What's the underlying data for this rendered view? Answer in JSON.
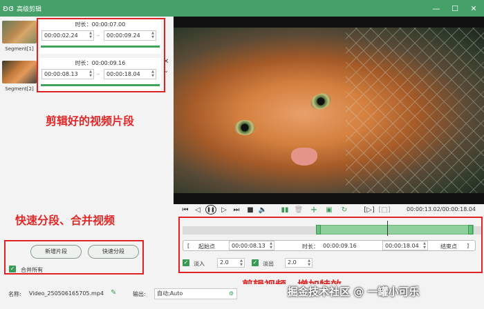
{
  "window": {
    "title": "高级剪辑",
    "min_icon": "minimize-icon",
    "max_icon": "maximize-icon",
    "close_icon": "close-icon"
  },
  "segments": [
    {
      "label": "Segment[1]",
      "duration": "时长：00:00:07.00",
      "start": "00:00:02.24",
      "end": "00:00:09.24"
    },
    {
      "label": "Segment[2]",
      "duration": "时长：00:00:09.16",
      "start": "00:00:08.13",
      "end": "00:00:18.04"
    }
  ],
  "annotations": {
    "clips": "剪辑好的视频片段",
    "split_merge": "快速分段、合并视频",
    "edit_effects": "剪辑视频、增加特效"
  },
  "left_buttons": {
    "add_segment": "新增片段",
    "quick_split": "快速分段",
    "merge_all": "合并所有"
  },
  "player": {
    "time_readout": "00:00:13.02/00:00:18.04"
  },
  "range": {
    "start_label": "起始点",
    "start_value": "00:00:08.13",
    "duration_label": "时长：",
    "duration_value": "00:00:09.16",
    "end_value": "00:00:18.04",
    "end_label": "结束点",
    "bracket_left": "[",
    "bracket_right": "]"
  },
  "fades": {
    "fade_in_label": "淡入",
    "fade_in_value": "2.0",
    "fade_out_label": "淡出",
    "fade_out_value": "2.0"
  },
  "footer": {
    "name_label": "名称:",
    "name_value": "Video_250506165705.mp4",
    "output_label": "输出:",
    "output_value": "自动;Auto"
  },
  "watermark": "掘金技术社区 @ 一罐小可乐",
  "colors": {
    "accent": "#45a06a",
    "annotation": "#e02828"
  }
}
